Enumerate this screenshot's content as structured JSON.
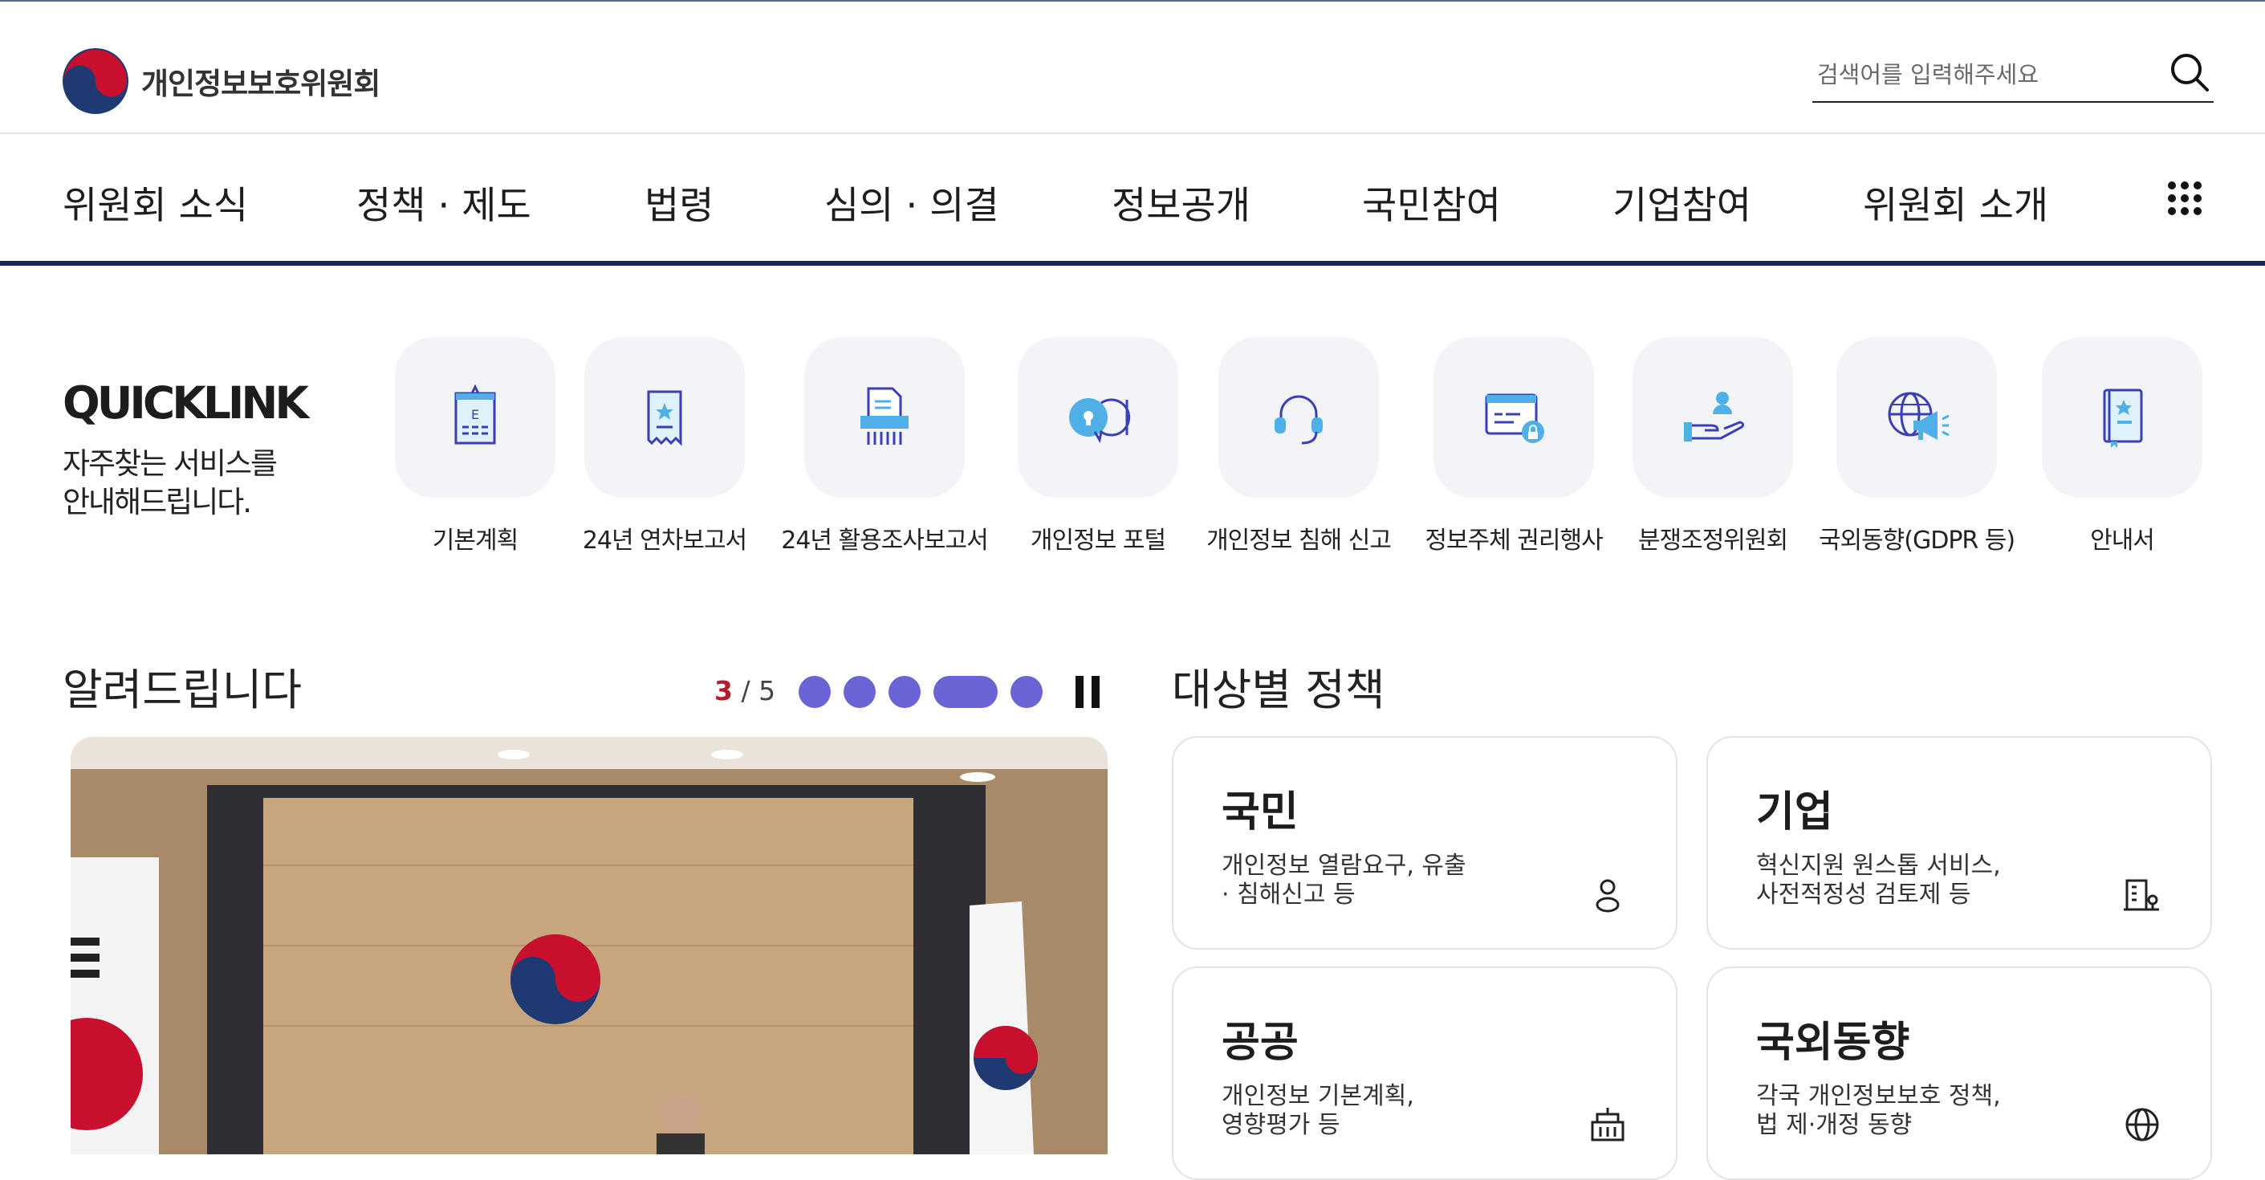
{
  "header": {
    "org_name": "개인정보보호위원회",
    "search_placeholder": "검색어를 입력해주세요"
  },
  "gnb": {
    "items": [
      "위원회 소식",
      "정책 · 제도",
      "법령",
      "심의 · 의결",
      "정보공개",
      "국민참여",
      "기업참여",
      "위원회 소개"
    ],
    "all_menu_icon": "grid-dots-icon"
  },
  "quick_link": {
    "title": "QUICKLINK",
    "subtitle_line1": "자주찾는 서비스를",
    "subtitle_line2": "안내해드립니다.",
    "items": [
      {
        "label": "기본계획",
        "icon": "plan-board-icon"
      },
      {
        "label": "24년 연차보고서",
        "icon": "report-ribbon-icon"
      },
      {
        "label": "24년 활용조사보고서",
        "icon": "shredder-document-icon"
      },
      {
        "label": "개인정보 포털",
        "icon": "portal-lock-icon"
      },
      {
        "label": "개인정보 침해 신고",
        "icon": "headset-icon"
      },
      {
        "label": "정보주체 권리행사",
        "icon": "browser-lock-icon"
      },
      {
        "label": "분쟁조정위원회",
        "icon": "hand-person-icon"
      },
      {
        "label": "국외동향(GDPR 등)",
        "icon": "globe-megaphone-icon"
      },
      {
        "label": "안내서",
        "icon": "guidebook-icon"
      }
    ]
  },
  "notice": {
    "title": "알려드립니다",
    "current": "3",
    "separator": " / ",
    "total": "5",
    "active_slide_index": 3,
    "slide_count": 5
  },
  "policy": {
    "title": "대상별 정책",
    "cards": [
      {
        "title": "국민",
        "desc_line1": "개인정보 열람요구, 유출",
        "desc_line2": "· 침해신고 등",
        "icon": "person-icon"
      },
      {
        "title": "기업",
        "desc_line1": "혁신지원 원스톱 서비스,",
        "desc_line2": "사전적정성 검토제 등",
        "icon": "building-icon"
      },
      {
        "title": "공공",
        "desc_line1": "개인정보 기본계획,",
        "desc_line2": "영향평가 등",
        "icon": "public-building-icon"
      },
      {
        "title": "국외동향",
        "desc_line1": "각국 개인정보보호 정책,",
        "desc_line2": "법 제·개정 동향",
        "icon": "globe-icon"
      }
    ]
  },
  "colors": {
    "nav_bar": "#14285a",
    "accent_purple": "#6a64d6",
    "pager_current": "#b11e2a",
    "icon_blue": "#4fb0e8",
    "icon_navy": "#3a3fb5"
  }
}
